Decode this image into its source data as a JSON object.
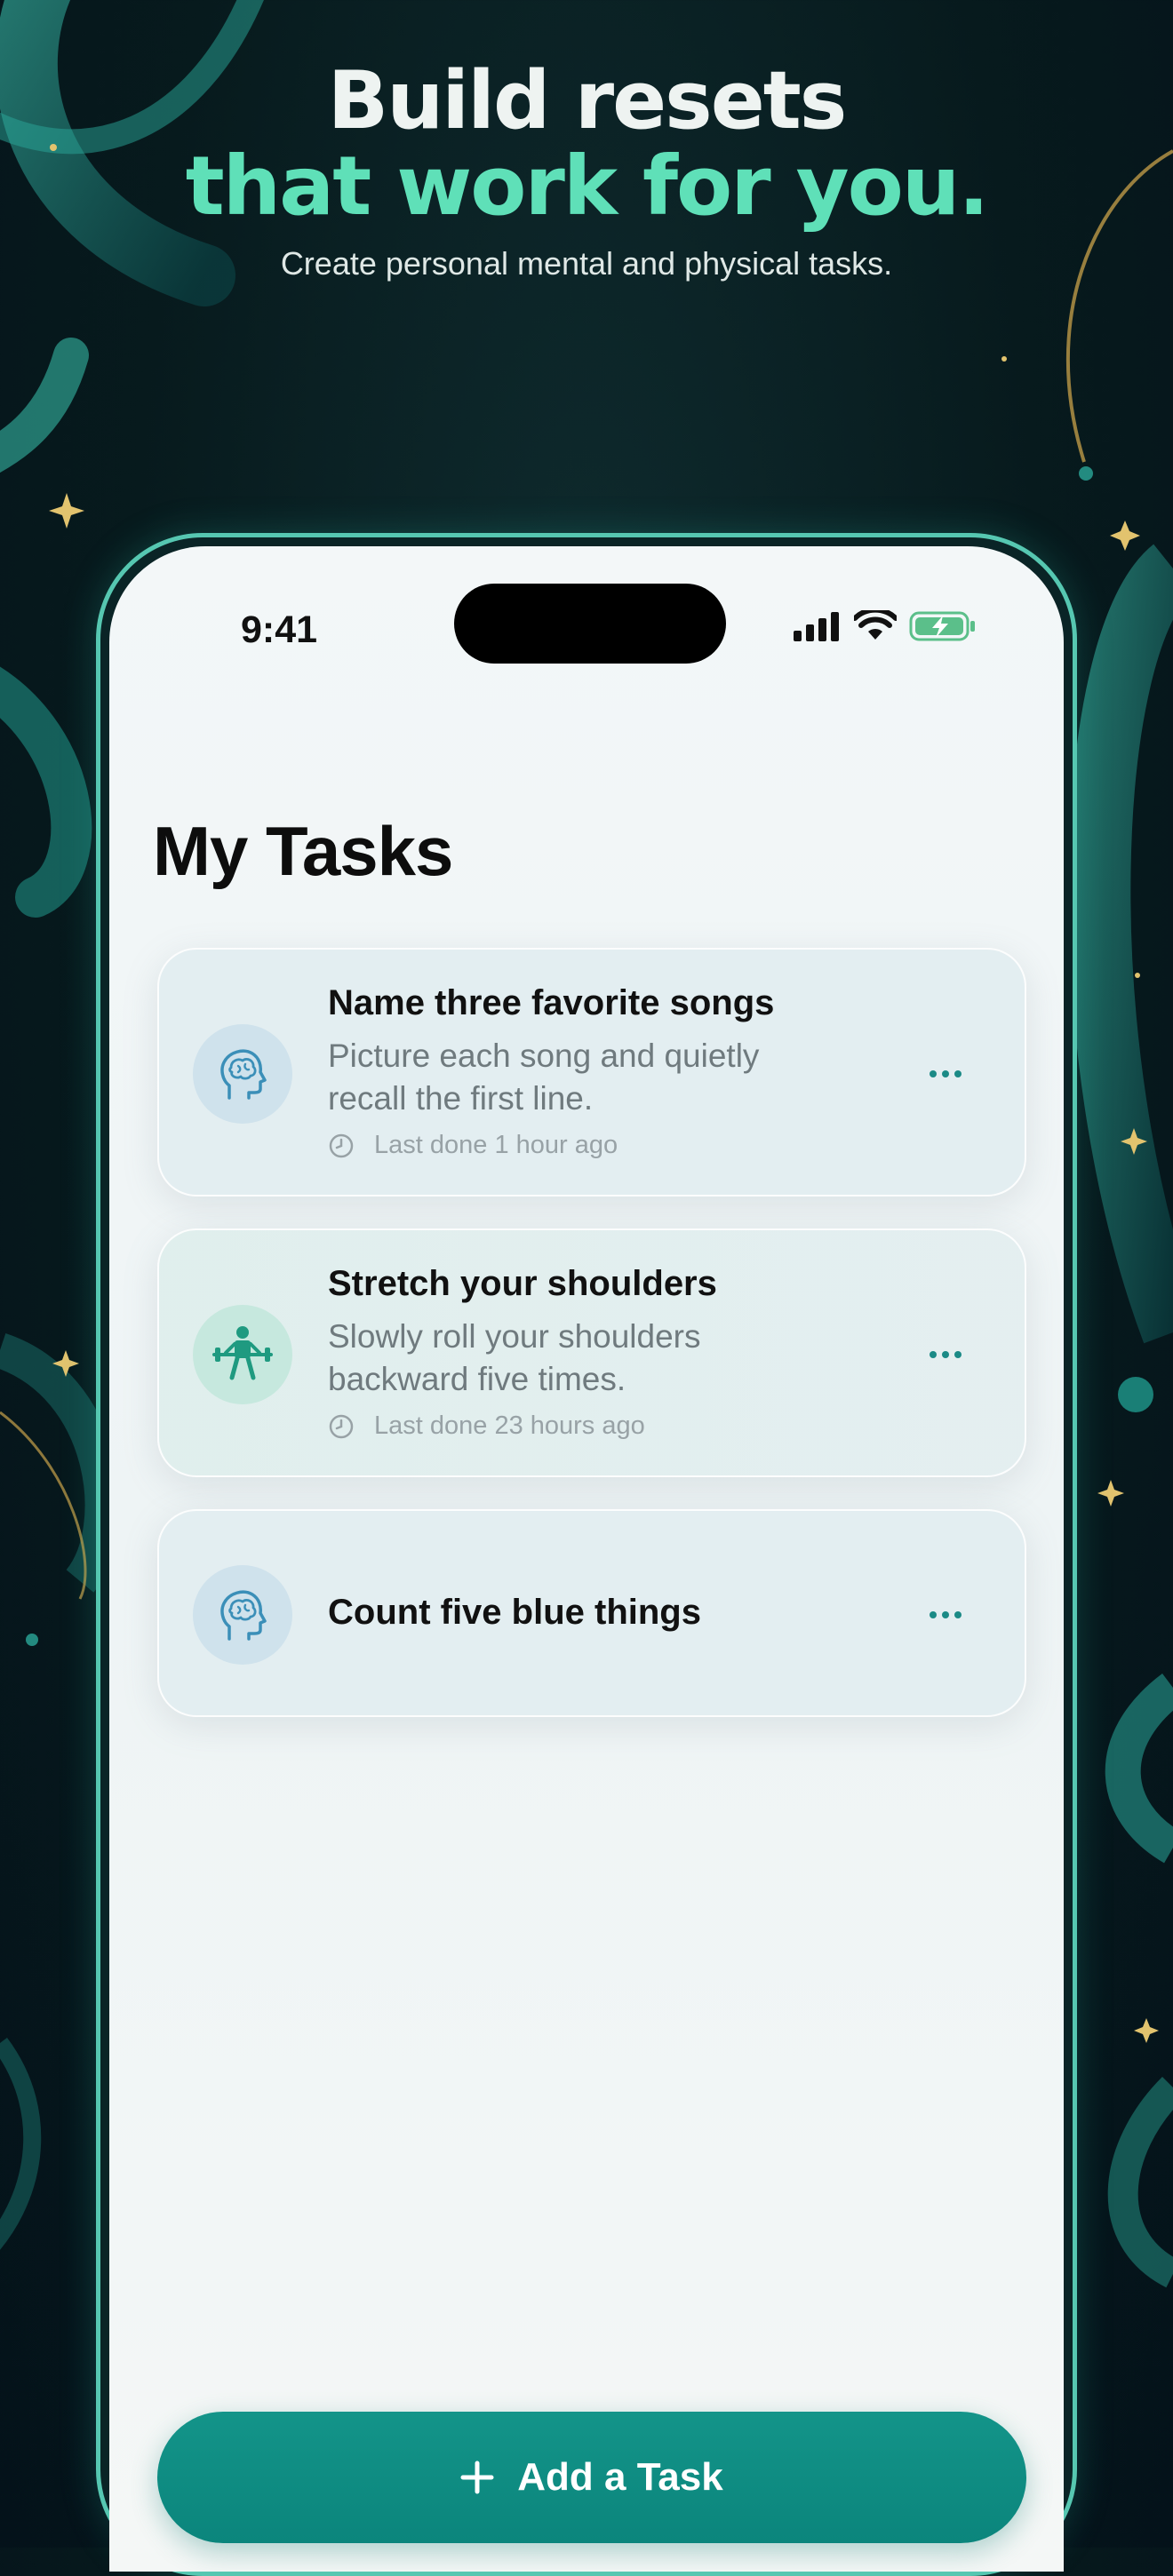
{
  "headline": {
    "line1": "Build resets",
    "line2": "that work for you.",
    "subtitle": "Create personal mental and physical tasks."
  },
  "status_bar": {
    "time": "9:41",
    "icons": [
      "cellular-signal-icon",
      "wifi-icon",
      "battery-charging-icon"
    ]
  },
  "screen": {
    "title": "My Tasks",
    "tasks": [
      {
        "icon": "brain-head-icon",
        "title": "Name three favorite songs",
        "description": "Picture each song and quietly recall the first line.",
        "meta": "Last done 1 hour ago"
      },
      {
        "icon": "weightlifter-icon",
        "title": "Stretch your shoulders",
        "description": "Slowly roll your shoulders backward five times.",
        "meta": "Last done 23 hours ago"
      },
      {
        "icon": "brain-head-icon",
        "title": "Count five blue things",
        "description": "",
        "meta": ""
      }
    ],
    "add_button": {
      "icon": "plus-icon",
      "label": "Add a Task"
    }
  },
  "colors": {
    "accent": "#0f8f86",
    "headline_green": "#5fe0b8",
    "background": "#071a1d"
  }
}
